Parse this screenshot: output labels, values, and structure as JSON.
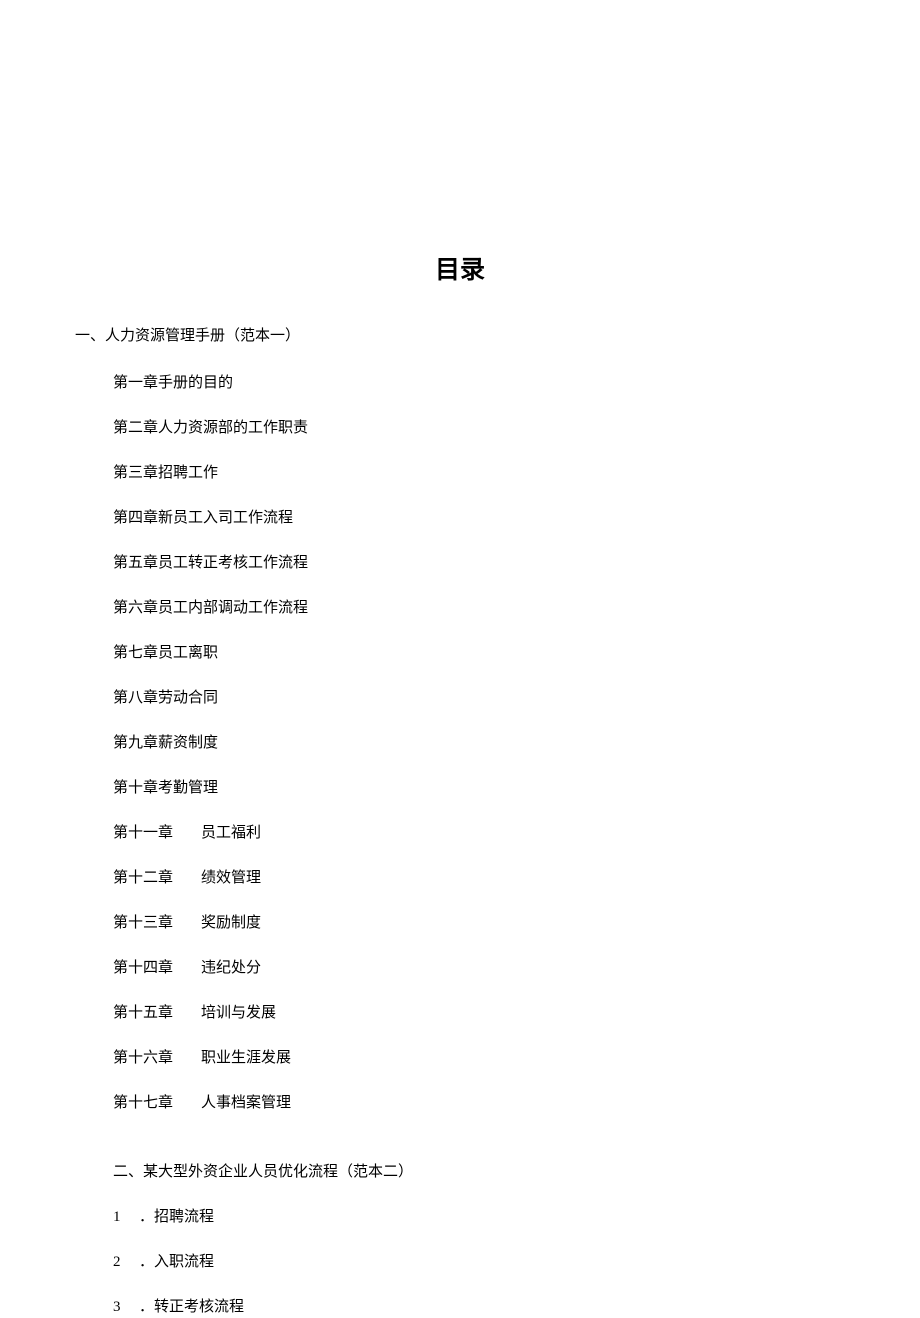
{
  "title": "目录",
  "section1": {
    "heading": "一、人力资源管理手册（范本一）",
    "items": [
      "第一章手册的目的",
      "第二章人力资源部的工作职责",
      "第三章招聘工作",
      "第四章新员工入司工作流程",
      "第五章员工转正考核工作流程",
      "第六章员工内部调动工作流程",
      "第七章员工离职",
      "第八章劳动合同",
      "第九章薪资制度",
      "第十章考勤管理"
    ],
    "split_items": [
      {
        "chapter": "第十一章",
        "title": "员工福利"
      },
      {
        "chapter": "第十二章",
        "title": "绩效管理"
      },
      {
        "chapter": "第十三章",
        "title": "奖励制度"
      },
      {
        "chapter": "第十四章",
        "title": "违纪处分"
      },
      {
        "chapter": "第十五章",
        "title": "培训与发展"
      },
      {
        "chapter": "第十六章",
        "title": "职业生涯发展"
      },
      {
        "chapter": "第十七章",
        "title": "人事档案管理"
      }
    ]
  },
  "section2": {
    "heading": "二、某大型外资企业人员优化流程（范本二）",
    "items": [
      {
        "num": "1",
        "title": "．招聘流程"
      },
      {
        "num": "2",
        "title": "．入职流程"
      },
      {
        "num": "3",
        "title": "．转正考核流程"
      }
    ]
  }
}
